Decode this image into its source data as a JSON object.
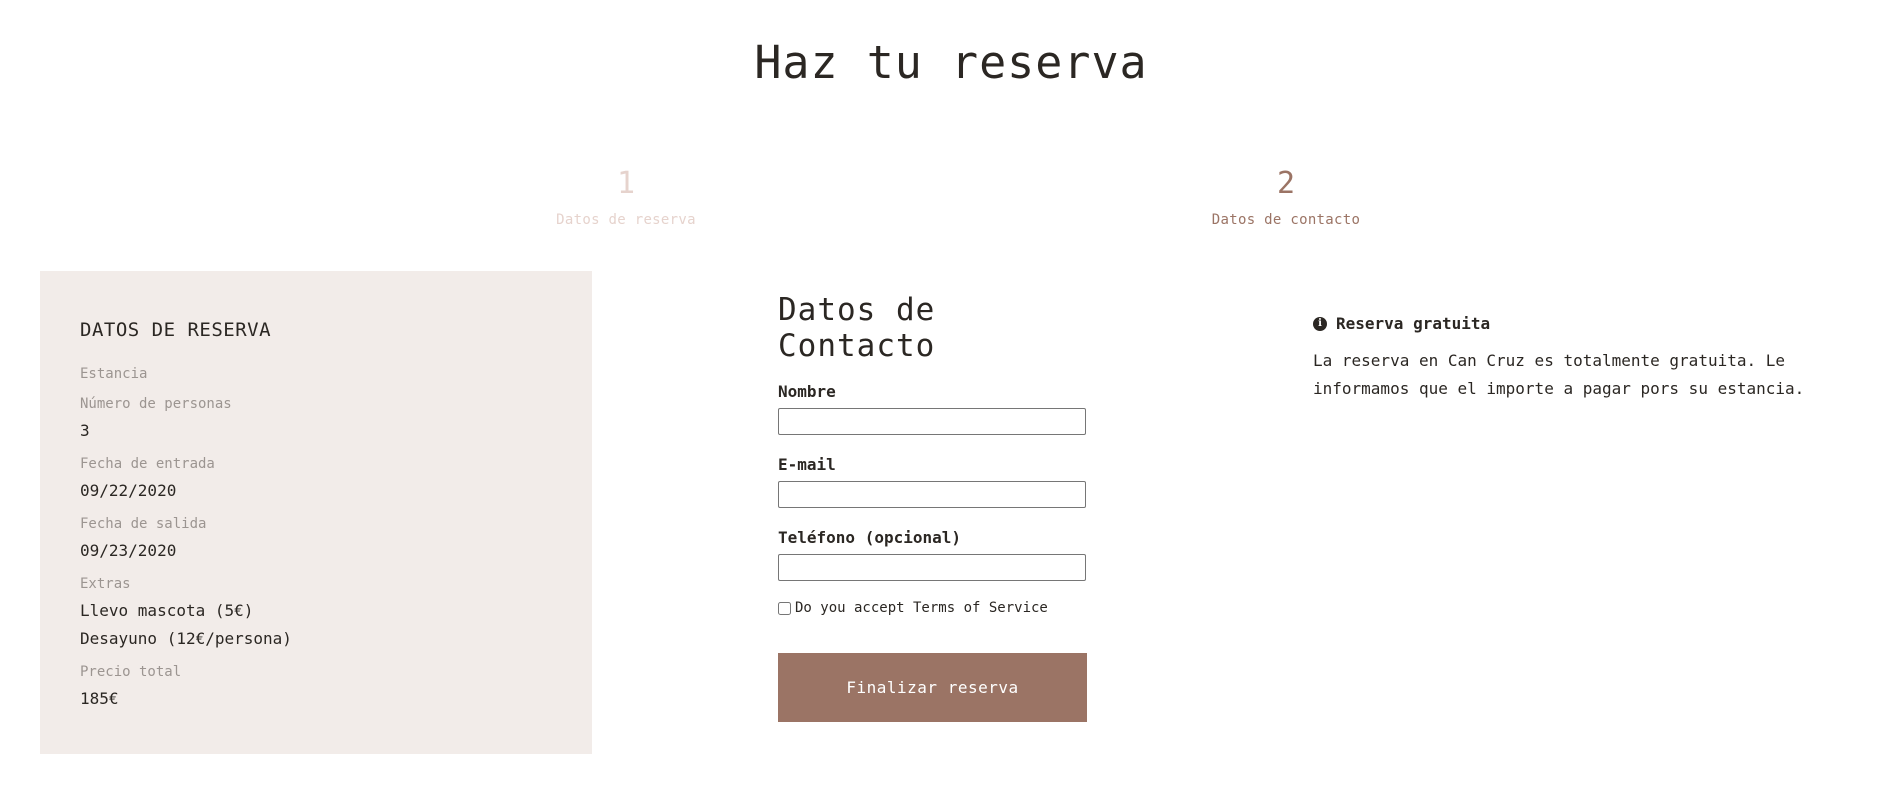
{
  "page": {
    "title": "Haz tu reserva"
  },
  "steps": [
    {
      "number": "1",
      "label": "Datos de reserva",
      "active": false
    },
    {
      "number": "2",
      "label": "Datos de contacto",
      "active": true
    }
  ],
  "summary": {
    "title": "DATOS DE RESERVA",
    "stay_label": "Estancia",
    "people_label": "Número de personas",
    "people_value": "3",
    "checkin_label": "Fecha de entrada",
    "checkin_value": "09/22/2020",
    "checkout_label": "Fecha de salida",
    "checkout_value": "09/23/2020",
    "extras_label": "Extras",
    "extras": [
      "Llevo mascota (5€)",
      "Desayuno (12€/persona)"
    ],
    "total_label": "Precio total",
    "total_value": "185€"
  },
  "contact": {
    "title": "Datos de Contacto",
    "name_label": "Nombre",
    "name_value": "",
    "email_label": "E-mail",
    "email_value": "",
    "phone_label": "Teléfono (opcional)",
    "phone_value": "",
    "terms_label": "Do you accept Terms of Service",
    "terms_checked": false,
    "submit_label": "Finalizar reserva"
  },
  "info": {
    "icon": "info-icon",
    "title": "Reserva gratuita",
    "text": "La reserva en Can Cruz es totalmente gratuita. Le informamos que el importe a pagar pors su estancia."
  },
  "colors": {
    "accent": "#9b7465",
    "accent_light": "#e6d3cd",
    "panel_bg": "#f2ece9",
    "text": "#2b2723",
    "muted": "#9c9591"
  }
}
